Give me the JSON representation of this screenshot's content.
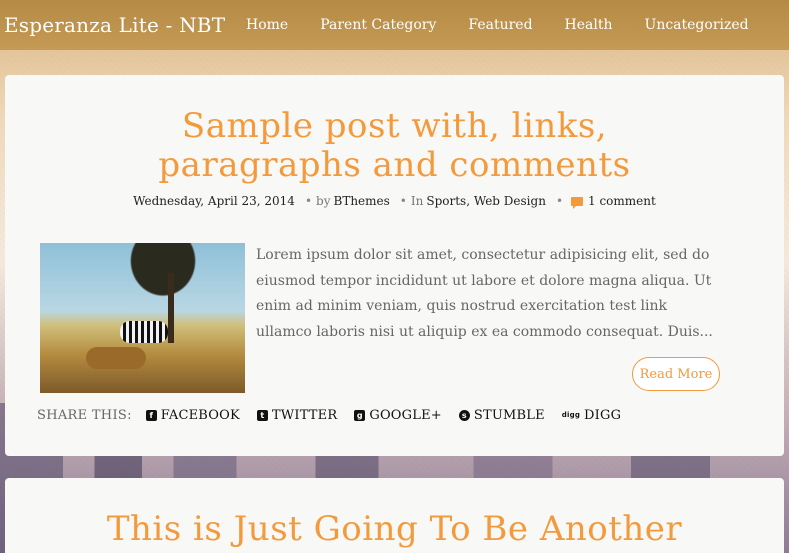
{
  "site": {
    "title": "Esperanza Lite - NBT"
  },
  "nav": [
    {
      "label": "Home"
    },
    {
      "label": "Parent Category"
    },
    {
      "label": "Featured"
    },
    {
      "label": "Health"
    },
    {
      "label": "Uncategorized"
    }
  ],
  "post1": {
    "title_line1": "Sample post with, links,",
    "title_line2": "paragraphs and comments",
    "date": "Wednesday, April 23, 2014",
    "by_prefix": "by",
    "author": "BThemes",
    "in_prefix": "In",
    "category1": "Sports",
    "category_sep": ",",
    "category2": "Web Design",
    "comments": "1 comment",
    "excerpt": "Lorem ipsum dolor sit amet, consectetur adipisicing elit, sed do eiusmod tempor incididunt ut labore et dolore magna aliqua. Ut enim ad minim veniam, quis nostrud exercitation test link ullamco laboris nisi ut aliquip ex ea commodo consequat. Duis...",
    "read_more": "Read More",
    "thumbnail_icon": "post-thumbnail-image"
  },
  "share": {
    "label": "SHARE THIS:",
    "items": [
      {
        "label": "FACEBOOK",
        "icon": "facebook-icon",
        "glyph": "f"
      },
      {
        "label": "TWITTER",
        "icon": "twitter-icon",
        "glyph": "t"
      },
      {
        "label": "GOOGLE+",
        "icon": "google-plus-icon",
        "glyph": "g"
      },
      {
        "label": "STUMBLE",
        "icon": "stumbleupon-icon",
        "glyph": "s"
      },
      {
        "label": "DIGG",
        "icon": "digg-icon",
        "glyph": "digg"
      }
    ]
  },
  "post2": {
    "title_line1": "This is Just Going To Be Another"
  },
  "colors": {
    "accent": "#f39a3c",
    "header": "#b58a45",
    "card": "#f8f8f6"
  }
}
